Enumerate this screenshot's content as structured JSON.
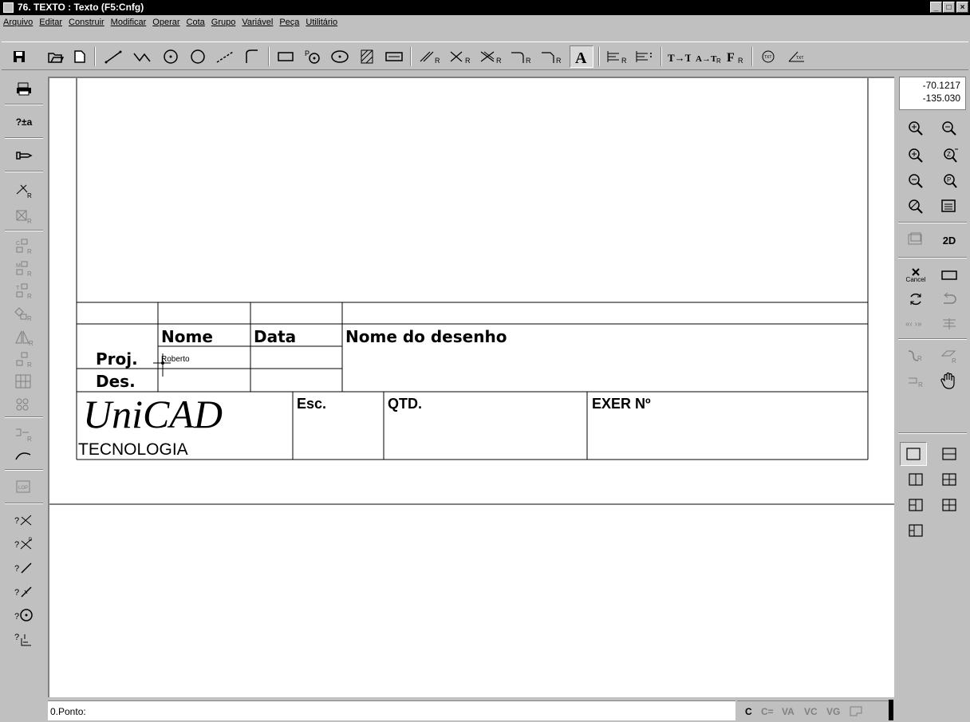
{
  "window": {
    "title": "76. TEXTO : Texto (F5:Cnfg)",
    "minimize": "_",
    "maximize": "□",
    "close": "×"
  },
  "menu": [
    "Arquivo",
    "Editar",
    "Construir",
    "Modificar",
    "Operar",
    "Cota",
    "Grupo",
    "Variável",
    "Peça",
    "Utilitário"
  ],
  "coords": {
    "x": "-70.1217",
    "y": "-135.030"
  },
  "right_panel": {
    "cancel_label": "Cancel",
    "mode_2d": "2D"
  },
  "left_panel": {
    "sign_label": "?±a"
  },
  "drawing": {
    "title_block": {
      "header_nome": "Nome",
      "header_data": "Data",
      "header_nome_desenho": "Nome do desenho",
      "row_proj": "Proj.",
      "row_des": "Des.",
      "proj_name": "Roberto",
      "logo_main": "UniCAD",
      "logo_sub": "TECNOLOGIA",
      "esc": "Esc.",
      "qtd": "QTD.",
      "exer": "EXER Nº"
    }
  },
  "status": {
    "prompt": "0.Ponto:",
    "flags": [
      "C",
      "C=",
      "VA",
      "VC",
      "VG"
    ]
  }
}
